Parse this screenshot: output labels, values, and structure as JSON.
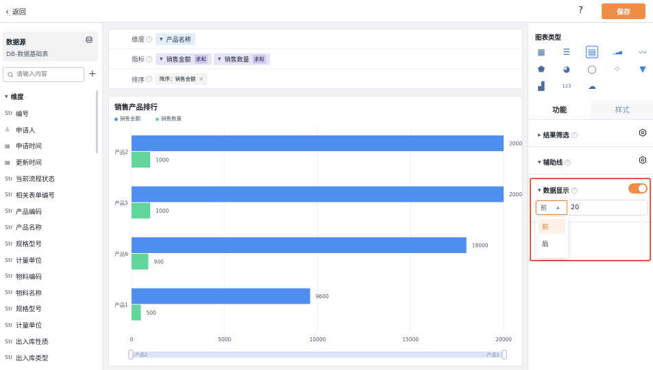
{
  "topbar": {
    "back_label": "返回",
    "help_label": "?",
    "save_label": "保存"
  },
  "left": {
    "datasource_title": "数据源",
    "datasource_name": "DB-数据基础表",
    "search_placeholder": "请输入内容",
    "dimension_header": "维度",
    "fields": [
      {
        "type": "Str",
        "name": "编号"
      },
      {
        "type": "person",
        "name": "申请人"
      },
      {
        "type": "date",
        "name": "申请时间"
      },
      {
        "type": "date",
        "name": "更新时间"
      },
      {
        "type": "Str",
        "name": "当前流程状态"
      },
      {
        "type": "Str",
        "name": "相关表单编号"
      },
      {
        "type": "Str",
        "name": "产品编码"
      },
      {
        "type": "Str",
        "name": "产品名称"
      },
      {
        "type": "Str",
        "name": "规格型号"
      },
      {
        "type": "Str",
        "name": "计量单位"
      },
      {
        "type": "Str",
        "name": "物料编码"
      },
      {
        "type": "Str",
        "name": "物料名称"
      },
      {
        "type": "Str",
        "name": "规格型号"
      },
      {
        "type": "Str",
        "name": "计量单位"
      },
      {
        "type": "Str",
        "name": "出入库性质"
      },
      {
        "type": "Str",
        "name": "出入库类型"
      }
    ]
  },
  "config": {
    "dimension_label": "维度",
    "dimension_chip": "产品名称",
    "metric_label": "指标",
    "metric_chips": [
      {
        "name": "销售金额",
        "agg": "求和"
      },
      {
        "name": "销售数量",
        "agg": "求和"
      }
    ],
    "sort_label": "排序",
    "sort_chip": "降序：销售金额"
  },
  "chart_data": {
    "type": "bar",
    "orientation": "horizontal",
    "title": "销售产品排行",
    "categories": [
      "产品2",
      "产品5",
      "产品6",
      "产品1"
    ],
    "series": [
      {
        "name": "销售金额",
        "color": "#4f8ff0",
        "values": [
          20000,
          20000,
          18000,
          9600
        ],
        "labels": [
          "2000",
          "2000",
          "18000",
          "9600"
        ]
      },
      {
        "name": "销售数量",
        "color": "#62d59c",
        "values": [
          1000,
          1000,
          900,
          500
        ],
        "labels": [
          "1000",
          "1000",
          "900",
          "500"
        ]
      }
    ],
    "xticks": [
      "0",
      "5000",
      "10000",
      "15000",
      "20000"
    ],
    "xlim": [
      0,
      20000
    ],
    "grid": true,
    "legend_position": "top-left",
    "zoom_labels": [
      "产品2",
      "产品1"
    ]
  },
  "right": {
    "chart_type_title": "图表类型",
    "chart_types": [
      "table-icon",
      "list-icon",
      "horizontal-bar-icon",
      "bar-icon",
      "line-icon",
      "radar-icon",
      "pie-icon",
      "donut-icon",
      "scatter-icon",
      "funnel-icon",
      "combo-icon",
      "number-card-icon",
      "map-icon"
    ],
    "tab_function": "功能",
    "tab_style": "样式",
    "section_filter": "结果筛选",
    "section_guide": "辅助线",
    "section_data_display": "数据显示",
    "toggle_on": true,
    "select_value": "前",
    "count_value": "20",
    "dropdown_options": [
      "前",
      "后"
    ]
  }
}
